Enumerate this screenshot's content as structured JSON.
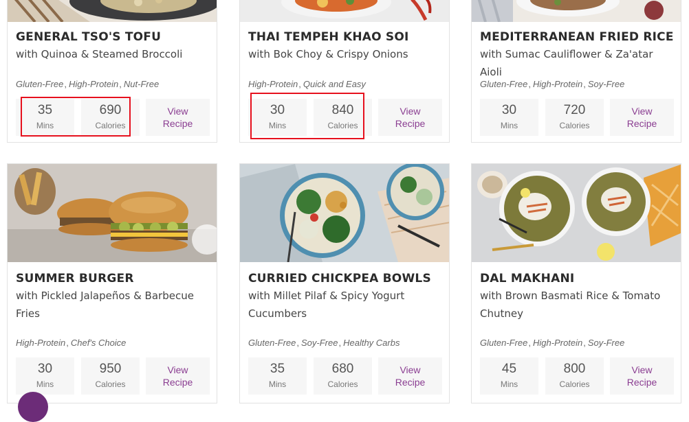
{
  "recipes": [
    {
      "title": "GENERAL TSO'S TOFU",
      "subtitle": "with Quinoa & Steamed Broccoli",
      "tags": [
        "Gluten-Free",
        "High-Protein",
        "Nut-Free"
      ],
      "mins": "35",
      "mins_label": "Mins",
      "calories": "690",
      "calories_label": "Calories",
      "view_label_1": "View",
      "view_label_2": "Recipe"
    },
    {
      "title": "THAI TEMPEH KHAO SOI",
      "subtitle": "with Bok Choy & Crispy Onions",
      "tags": [
        "High-Protein",
        "Quick and Easy"
      ],
      "mins": "30",
      "mins_label": "Mins",
      "calories": "840",
      "calories_label": "Calories",
      "view_label_1": "View",
      "view_label_2": "Recipe"
    },
    {
      "title": "MEDITERRANEAN FRIED RICE",
      "subtitle": "with Sumac Cauliflower & Za'atar Aioli",
      "tags": [
        "Gluten-Free",
        "High-Protein",
        "Soy-Free"
      ],
      "mins": "30",
      "mins_label": "Mins",
      "calories": "720",
      "calories_label": "Calories",
      "view_label_1": "View",
      "view_label_2": "Recipe"
    },
    {
      "title": "SUMMER BURGER",
      "subtitle_1": "with Pickled Jalapeños & Barbecue",
      "subtitle_2": "Fries",
      "tags": [
        "High-Protein",
        "Chef's Choice"
      ],
      "mins": "30",
      "mins_label": "Mins",
      "calories": "950",
      "calories_label": "Calories",
      "view_label_1": "View",
      "view_label_2": "Recipe"
    },
    {
      "title": "CURRIED CHICKPEA BOWLS",
      "subtitle_1": "with Millet Pilaf & Spicy Yogurt",
      "subtitle_2": "Cucumbers",
      "tags": [
        "Gluten-Free",
        "Soy-Free",
        "Healthy Carbs"
      ],
      "mins": "35",
      "mins_label": "Mins",
      "calories": "680",
      "calories_label": "Calories",
      "view_label_1": "View",
      "view_label_2": "Recipe"
    },
    {
      "title": "DAL MAKHANI",
      "subtitle_1": "with Brown Basmati Rice & Tomato",
      "subtitle_2": "Chutney",
      "tags": [
        "Gluten-Free",
        "High-Protein",
        "Soy-Free"
      ],
      "mins": "45",
      "mins_label": "Mins",
      "calories": "800",
      "calories_label": "Calories",
      "view_label_1": "View",
      "view_label_2": "Recipe"
    }
  ],
  "separator": ",",
  "colors": {
    "accent": "#8a3d91",
    "highlight": "#e6101d",
    "stat_bg": "#f6f6f6"
  }
}
